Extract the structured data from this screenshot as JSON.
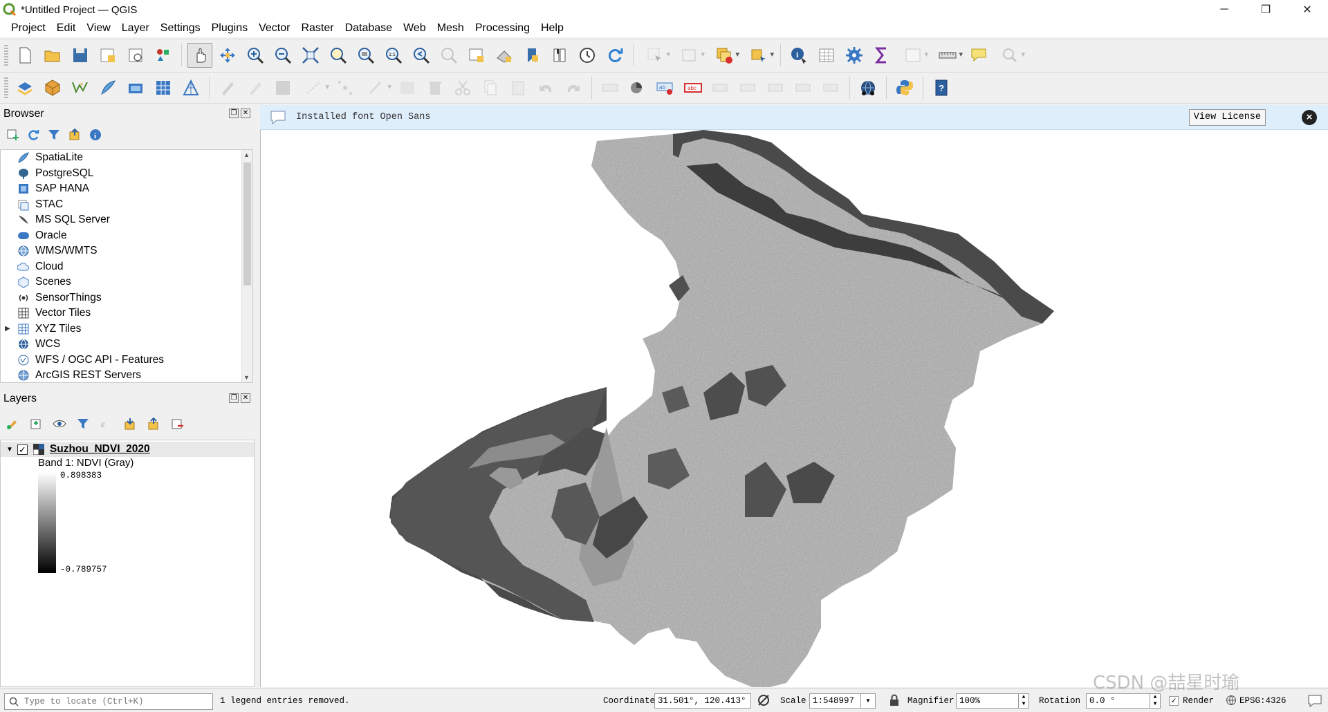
{
  "window": {
    "title": "*Untitled Project — QGIS",
    "controls": [
      "─",
      "❐",
      "✕"
    ]
  },
  "menu": [
    "Project",
    "Edit",
    "View",
    "Layer",
    "Settings",
    "Plugins",
    "Vector",
    "Raster",
    "Database",
    "Web",
    "Mesh",
    "Processing",
    "Help"
  ],
  "browser": {
    "title": "Browser",
    "items": [
      {
        "label": "SpatiaLite",
        "icon": "spatialite-icon"
      },
      {
        "label": "PostgreSQL",
        "icon": "postgresql-icon"
      },
      {
        "label": "SAP HANA",
        "icon": "sap-hana-icon"
      },
      {
        "label": "STAC",
        "icon": "stac-icon"
      },
      {
        "label": "MS SQL Server",
        "icon": "mssql-icon"
      },
      {
        "label": "Oracle",
        "icon": "oracle-icon"
      },
      {
        "label": "WMS/WMTS",
        "icon": "wms-icon"
      },
      {
        "label": "Cloud",
        "icon": "cloud-icon"
      },
      {
        "label": "Scenes",
        "icon": "scenes-icon"
      },
      {
        "label": "SensorThings",
        "icon": "sensorthings-icon"
      },
      {
        "label": "Vector Tiles",
        "icon": "vector-tiles-icon"
      },
      {
        "label": "XYZ Tiles",
        "icon": "xyz-tiles-icon",
        "expandable": true
      },
      {
        "label": "WCS",
        "icon": "wcs-icon"
      },
      {
        "label": "WFS / OGC API - Features",
        "icon": "wfs-icon"
      },
      {
        "label": "ArcGIS REST Servers",
        "icon": "arcgis-icon"
      }
    ]
  },
  "layers": {
    "title": "Layers",
    "layer_name": "Suzhou_NDVI_2020",
    "band_label": "Band 1: NDVI (Gray)",
    "max_value": "0.898383",
    "min_value": "-0.789757"
  },
  "message_bar": {
    "text": "Installed font Open Sans",
    "button": "View License"
  },
  "status": {
    "locator_placeholder": "Type to locate (Ctrl+K)",
    "message": "1 legend entries removed.",
    "coordinate_label": "Coordinate",
    "coordinate": "31.501°, 120.413°",
    "scale_label": "Scale",
    "scale": "1:548997",
    "magnifier_label": "Magnifier",
    "magnifier": "100%",
    "rotation_label": "Rotation",
    "rotation": "0.0 °",
    "render_label": "Render",
    "crs": "EPSG:4326"
  },
  "watermark": "CSDN @喆星时瑜"
}
